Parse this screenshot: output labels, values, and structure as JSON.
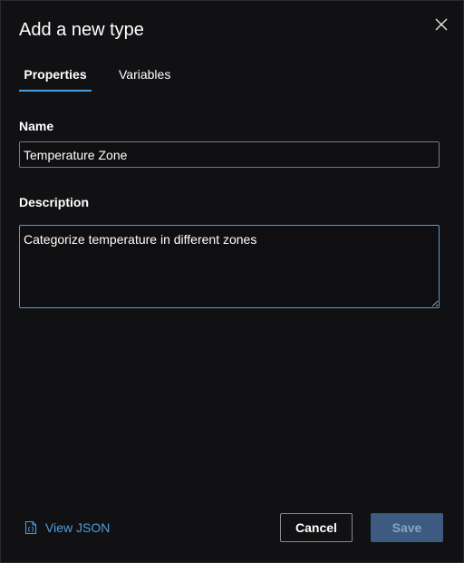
{
  "dialog": {
    "title": "Add a new type",
    "close_icon": "close-icon"
  },
  "tabs": [
    {
      "label": "Properties",
      "active": true
    },
    {
      "label": "Variables",
      "active": false
    }
  ],
  "form": {
    "name_label": "Name",
    "name_value": "Temperature Zone",
    "description_label": "Description",
    "description_value": "Categorize temperature in different zones"
  },
  "footer": {
    "view_json_label": "View JSON",
    "view_json_icon": "json-file-icon",
    "cancel_label": "Cancel",
    "save_label": "Save",
    "save_enabled": false
  },
  "colors": {
    "background": "#111113",
    "accent": "#4b9ee5",
    "save_disabled_bg": "#3d5a80"
  }
}
